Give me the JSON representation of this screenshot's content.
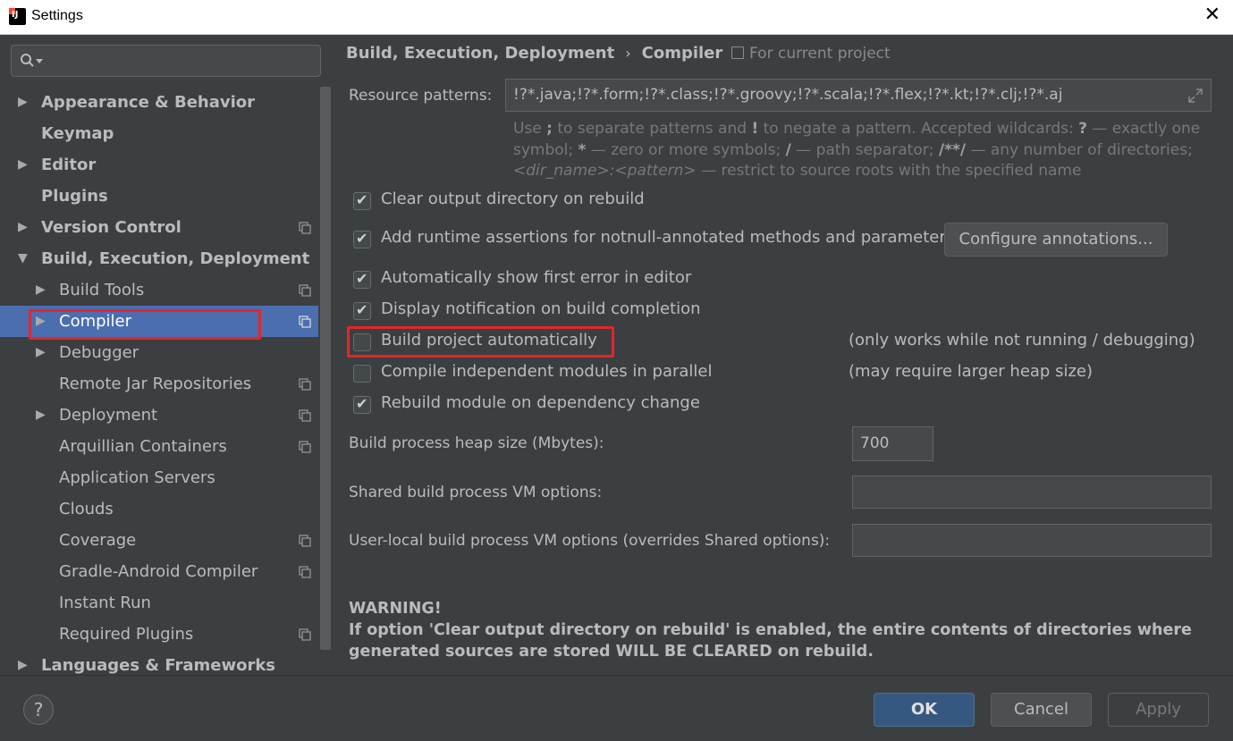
{
  "window": {
    "title": "Settings",
    "close_glyph": "✕"
  },
  "sidebar": {
    "search_placeholder": "",
    "items": [
      {
        "label": "Appearance & Behavior",
        "level": 0,
        "arrow": "▶",
        "bold": true,
        "project": false
      },
      {
        "label": "Keymap",
        "level": 0,
        "arrow": "",
        "bold": true,
        "project": false
      },
      {
        "label": "Editor",
        "level": 0,
        "arrow": "▶",
        "bold": true,
        "project": false
      },
      {
        "label": "Plugins",
        "level": 0,
        "arrow": "",
        "bold": true,
        "project": false
      },
      {
        "label": "Version Control",
        "level": 0,
        "arrow": "▶",
        "bold": true,
        "project": true
      },
      {
        "label": "Build, Execution, Deployment",
        "level": 0,
        "arrow": "▼",
        "bold": true,
        "project": false
      },
      {
        "label": "Build Tools",
        "level": 1,
        "arrow": "▶",
        "bold": false,
        "project": true
      },
      {
        "label": "Compiler",
        "level": 1,
        "arrow": "▶",
        "bold": false,
        "project": true,
        "selected": true
      },
      {
        "label": "Debugger",
        "level": 1,
        "arrow": "▶",
        "bold": false,
        "project": false
      },
      {
        "label": "Remote Jar Repositories",
        "level": 1,
        "arrow": "",
        "bold": false,
        "project": true
      },
      {
        "label": "Deployment",
        "level": 1,
        "arrow": "▶",
        "bold": false,
        "project": true
      },
      {
        "label": "Arquillian Containers",
        "level": 1,
        "arrow": "",
        "bold": false,
        "project": true
      },
      {
        "label": "Application Servers",
        "level": 1,
        "arrow": "",
        "bold": false,
        "project": false
      },
      {
        "label": "Clouds",
        "level": 1,
        "arrow": "",
        "bold": false,
        "project": false
      },
      {
        "label": "Coverage",
        "level": 1,
        "arrow": "",
        "bold": false,
        "project": true
      },
      {
        "label": "Gradle-Android Compiler",
        "level": 1,
        "arrow": "",
        "bold": false,
        "project": true
      },
      {
        "label": "Instant Run",
        "level": 1,
        "arrow": "",
        "bold": false,
        "project": false
      },
      {
        "label": "Required Plugins",
        "level": 1,
        "arrow": "",
        "bold": false,
        "project": true
      },
      {
        "label": "Languages & Frameworks",
        "level": 0,
        "arrow": "▶",
        "bold": true,
        "project": false
      }
    ]
  },
  "content": {
    "breadcrumb": [
      "Build, Execution, Deployment",
      "Compiler"
    ],
    "breadcrumb_sep": "›",
    "for_current_project": "For current project",
    "resource_patterns_label": "Resource patterns:",
    "resource_patterns_value": "!?*.java;!?*.form;!?*.class;!?*.groovy;!?*.scala;!?*.flex;!?*.kt;!?*.clj;!?*.aj",
    "hint_line1_parts": [
      "Use ",
      ";",
      " to separate patterns and ",
      "!",
      " to negate a pattern. Accepted wildcards: ",
      "?",
      " — exactly one"
    ],
    "hint_line2_parts": [
      "symbol; ",
      "*",
      " — zero or more symbols; ",
      "/",
      " — path separator; ",
      "/**/",
      " — any number of directories;"
    ],
    "hint_line3_italic": "<dir_name>:<pattern>",
    "hint_line3_rest": " — restrict to source roots with the specified name",
    "options": [
      {
        "label": "Clear output directory on rebuild",
        "checked": true,
        "note": ""
      },
      {
        "label": "Add runtime assertions for notnull-annotated methods and parameters",
        "checked": true,
        "note": ""
      },
      {
        "label": "Automatically show first error in editor",
        "checked": true,
        "note": ""
      },
      {
        "label": "Display notification on build completion",
        "checked": true,
        "note": ""
      },
      {
        "label": "Build project automatically",
        "checked": false,
        "note": "(only works while not running / debugging)"
      },
      {
        "label": "Compile independent modules in parallel",
        "checked": false,
        "note": "(may require larger heap size)"
      },
      {
        "label": "Rebuild module on dependency change",
        "checked": true,
        "note": ""
      }
    ],
    "configure_annotations_label": "Configure annotations...",
    "heap_size_label": "Build process heap size (Mbytes):",
    "heap_size_value": "700",
    "shared_vm_label": "Shared build process VM options:",
    "shared_vm_value": "",
    "user_vm_label": "User-local build process VM options (overrides Shared options):",
    "user_vm_value": "",
    "warning_title": "WARNING!",
    "warning_text": "If option 'Clear output directory on rebuild' is enabled, the entire contents of directories where generated sources are stored WILL BE CLEARED on rebuild."
  },
  "footer": {
    "help_label": "?",
    "ok_label": "OK",
    "cancel_label": "Cancel",
    "apply_label": "Apply"
  },
  "colors": {
    "background": "#3c3f41",
    "selection": "#4b6eaf",
    "ok_button": "#365880",
    "highlight_box": "#e3262a"
  }
}
